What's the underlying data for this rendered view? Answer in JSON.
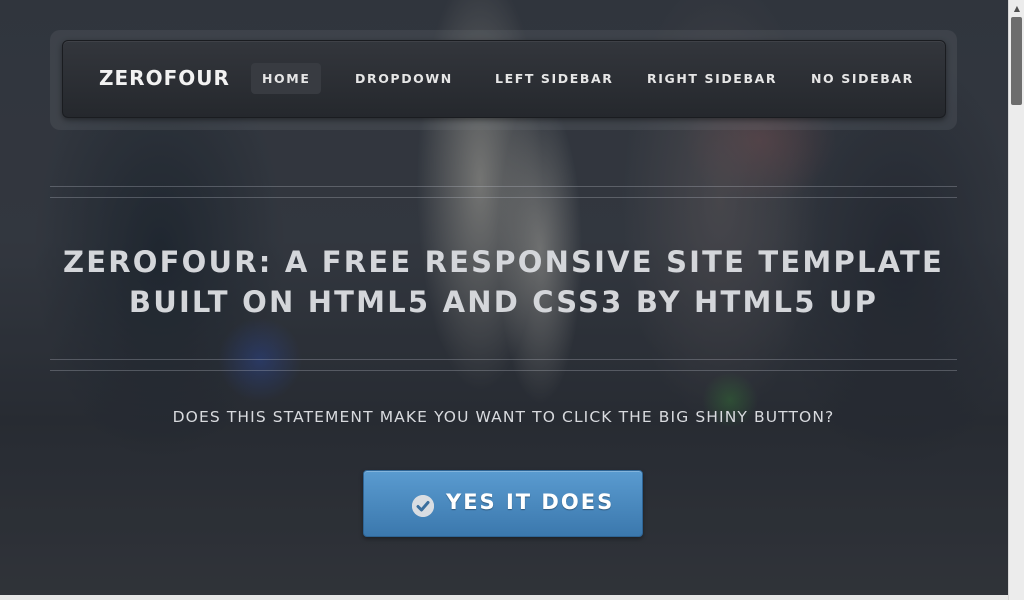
{
  "header": {
    "logo": "ZEROFOUR",
    "nav": [
      {
        "label": "HOME",
        "active": true
      },
      {
        "label": "DROPDOWN",
        "active": false
      },
      {
        "label": "LEFT SIDEBAR",
        "active": false
      },
      {
        "label": "RIGHT SIDEBAR",
        "active": false
      },
      {
        "label": "NO SIDEBAR",
        "active": false
      }
    ]
  },
  "banner": {
    "headline_line1": "ZEROFOUR: A FREE RESPONSIVE SITE TEMPLATE",
    "headline_line2": "BUILT ON HTML5 AND CSS3 BY HTML5 UP",
    "statement": "DOES THIS STATEMENT MAKE YOU WANT TO CLICK THE BIG SHINY BUTTON?",
    "cta_label": "YES IT DOES",
    "cta_icon": "check-circle-icon"
  },
  "colors": {
    "accent": "#4a8cc4",
    "nav_bg": "#2a2d32",
    "text_light": "#e6e6e6"
  }
}
